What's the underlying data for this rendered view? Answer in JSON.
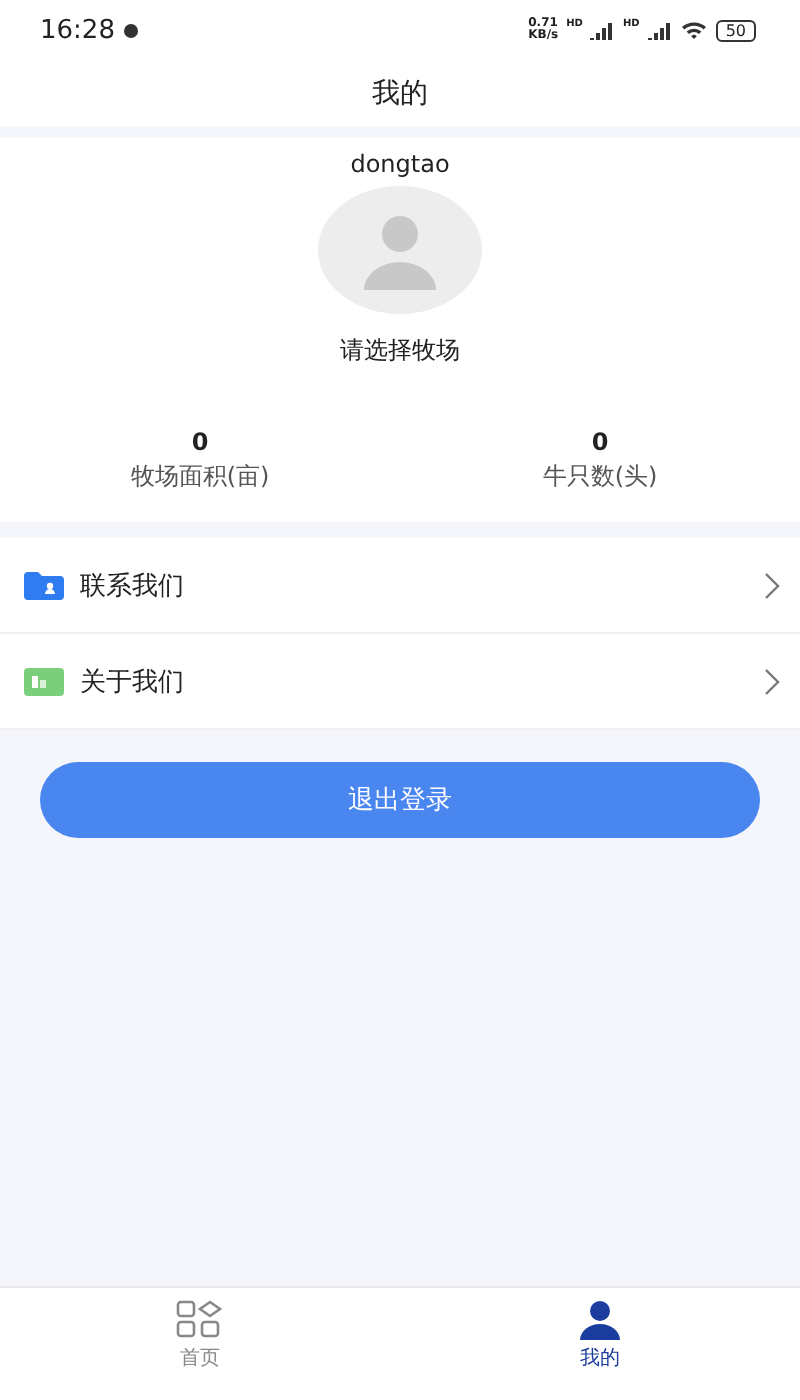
{
  "status_bar": {
    "time": "16:28",
    "speed": "0.71\nKB/s",
    "network": [
      "HD",
      "HD"
    ],
    "battery": "50"
  },
  "header": {
    "title": "我的"
  },
  "profile": {
    "username": "dongtao",
    "farm_prompt": "请选择牧场"
  },
  "stats": [
    {
      "value": "0",
      "label": "牧场面积(亩)"
    },
    {
      "value": "0",
      "label": "牛只数(头)"
    }
  ],
  "menu": [
    {
      "label": "联系我们",
      "color": "#2f7cf0",
      "kind": "contact"
    },
    {
      "label": "关于我们",
      "color": "#7ccf7a",
      "kind": "about"
    }
  ],
  "logout_button": "退出登录",
  "tab_bar": [
    {
      "label": "首页",
      "kind": "home",
      "selected": false
    },
    {
      "label": "我的",
      "kind": "me",
      "selected": true
    }
  ]
}
